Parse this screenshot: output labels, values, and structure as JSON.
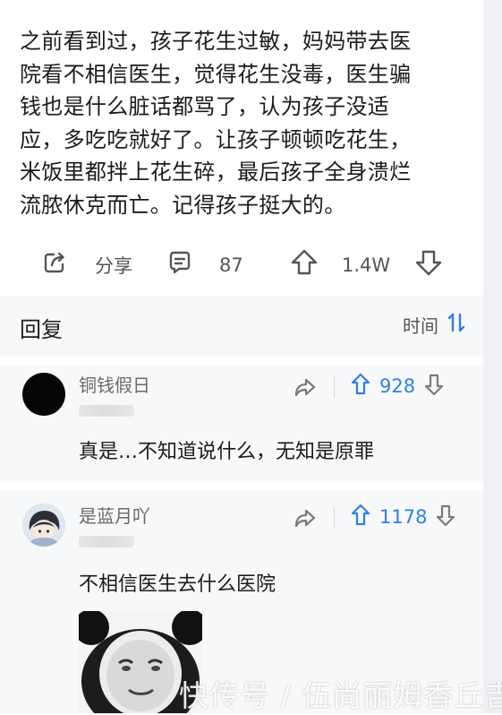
{
  "post": {
    "text_lines": [
      "之前看到过，孩子花生过敏，妈妈带去医",
      "院看不相信医生，觉得花生没毒，医生骗",
      "钱也是什么脏话都骂了，认为孩子没适",
      "应，多吃吃就好了。让孩子顿顿吃花生，",
      "米饭里都拌上花生碎，最后孩子全身溃烂",
      "流脓休克而亡。记得孩子挺大的。"
    ]
  },
  "actions": {
    "share_label": "分享",
    "comment_count": "87",
    "upvote_count": "1.4W"
  },
  "replies": {
    "title": "回复",
    "sort_label": "时间"
  },
  "comments": [
    {
      "username": "铜钱假日",
      "votes": "928",
      "text": "真是…不知道说什么，无知是原罪"
    },
    {
      "username": "是蓝月吖",
      "votes": "1178",
      "text": "不相信医生去什么医院"
    }
  ],
  "watermark": "快传号 / 伍尚丽姆香丘吉",
  "colors": {
    "accent": "#2f7ee6",
    "reply_bg": "#f7f8fa"
  },
  "icons": [
    "share-icon",
    "comment-icon",
    "upvote-icon",
    "downvote-icon",
    "sort-icon",
    "forward-icon"
  ]
}
